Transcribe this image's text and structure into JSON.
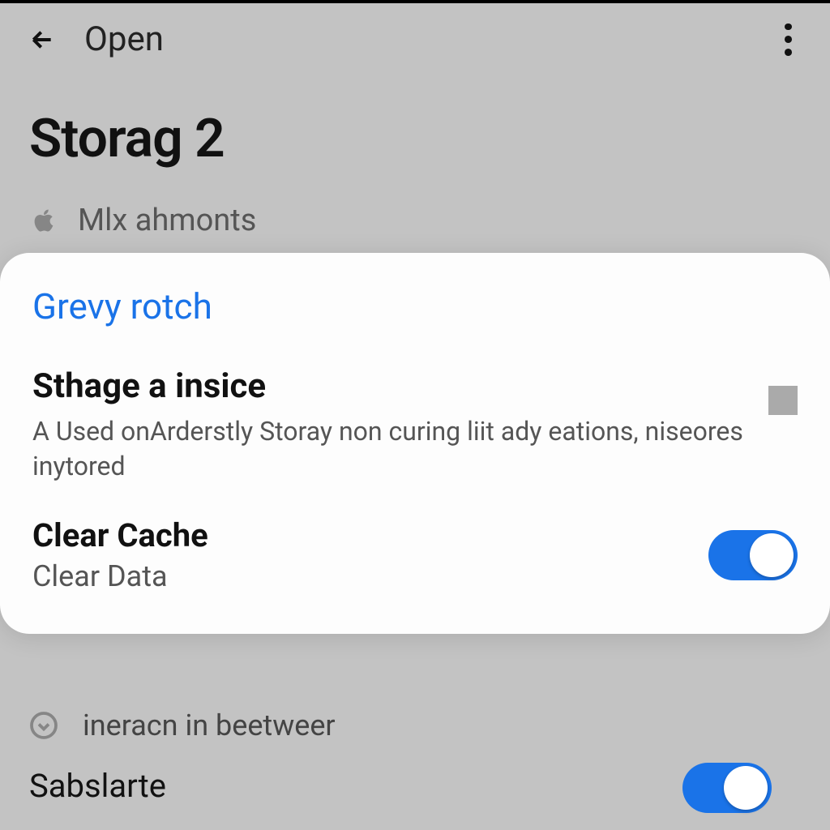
{
  "toolbar": {
    "title": "Open"
  },
  "page": {
    "title": "Storag 2"
  },
  "background": {
    "item1_label": "Mlx ahmonts",
    "item2_label": "ineracn in beetweer",
    "item3_title": "Sabslarte"
  },
  "sheet": {
    "title": "Grevy rotch",
    "setting1": {
      "primary": "Sthage a insice",
      "secondary": "A Used onArderstly Storay non curing liit ady eations, niseores inytored"
    },
    "setting2": {
      "primary": "Clear Cache",
      "secondary": "Clear Data"
    }
  },
  "colors": {
    "accent": "#1a73e8",
    "bg": "#c3c3c3",
    "sheet": "#fdfdfd"
  }
}
